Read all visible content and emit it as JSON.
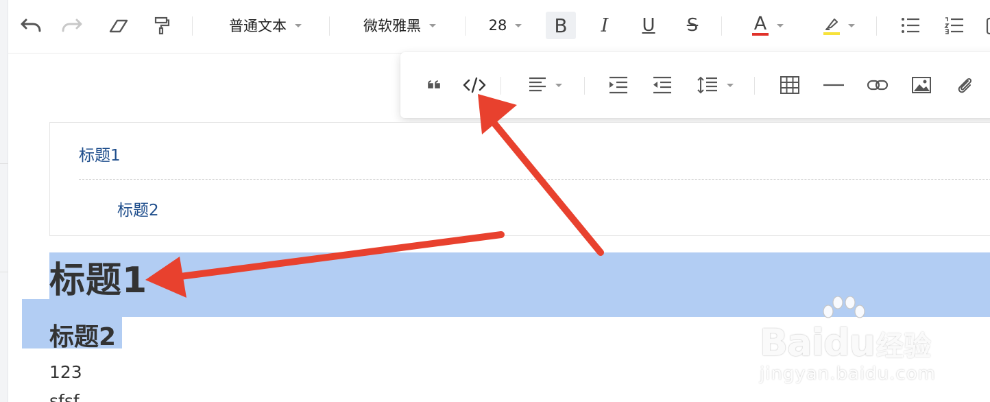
{
  "toolbar": {
    "paragraph_style": "普通文本",
    "font_family": "微软雅黑",
    "font_size": "28",
    "bold_label": "B",
    "italic_label": "I",
    "underline_label": "U",
    "strike_label": "S",
    "font_color_label": "A",
    "font_color": "#e0322a",
    "highlight_color": "#f7e23b"
  },
  "toc": {
    "items": [
      {
        "label": "标题1",
        "level": 1
      },
      {
        "label": "标题2",
        "level": 2
      }
    ]
  },
  "document": {
    "heading1": "标题1",
    "heading2": "标题2",
    "paragraph1": "123",
    "paragraph2": "sfsf"
  },
  "selection_color": "#b2cdf3",
  "annotation_color": "#e8412e",
  "watermark": {
    "brand": "Baidu",
    "brand_cn": "经验",
    "url": "jingyan.baidu.com"
  }
}
